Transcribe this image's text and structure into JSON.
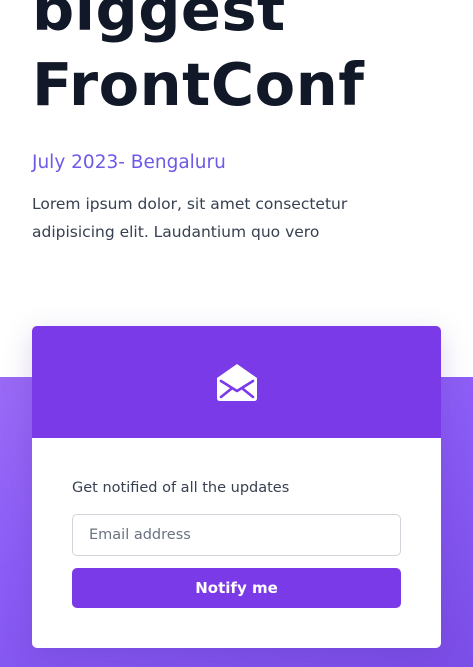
{
  "hero": {
    "title_line1": "biggest",
    "title_line2": "FrontConf",
    "date_location": "July 2023- Bengaluru",
    "description": "Lorem ipsum dolor, sit amet consectetur adipisicing elit. Laudantium quo vero"
  },
  "signup_card": {
    "icon": "envelope-open-icon",
    "label": "Get notified of all the updates",
    "email_placeholder": "Email address",
    "email_value": "",
    "button_label": "Notify me"
  },
  "colors": {
    "accent": "#7a3ae8",
    "accent_light": "#8b5cf6",
    "date_text": "#6d5ae6",
    "title_text": "#111827"
  }
}
